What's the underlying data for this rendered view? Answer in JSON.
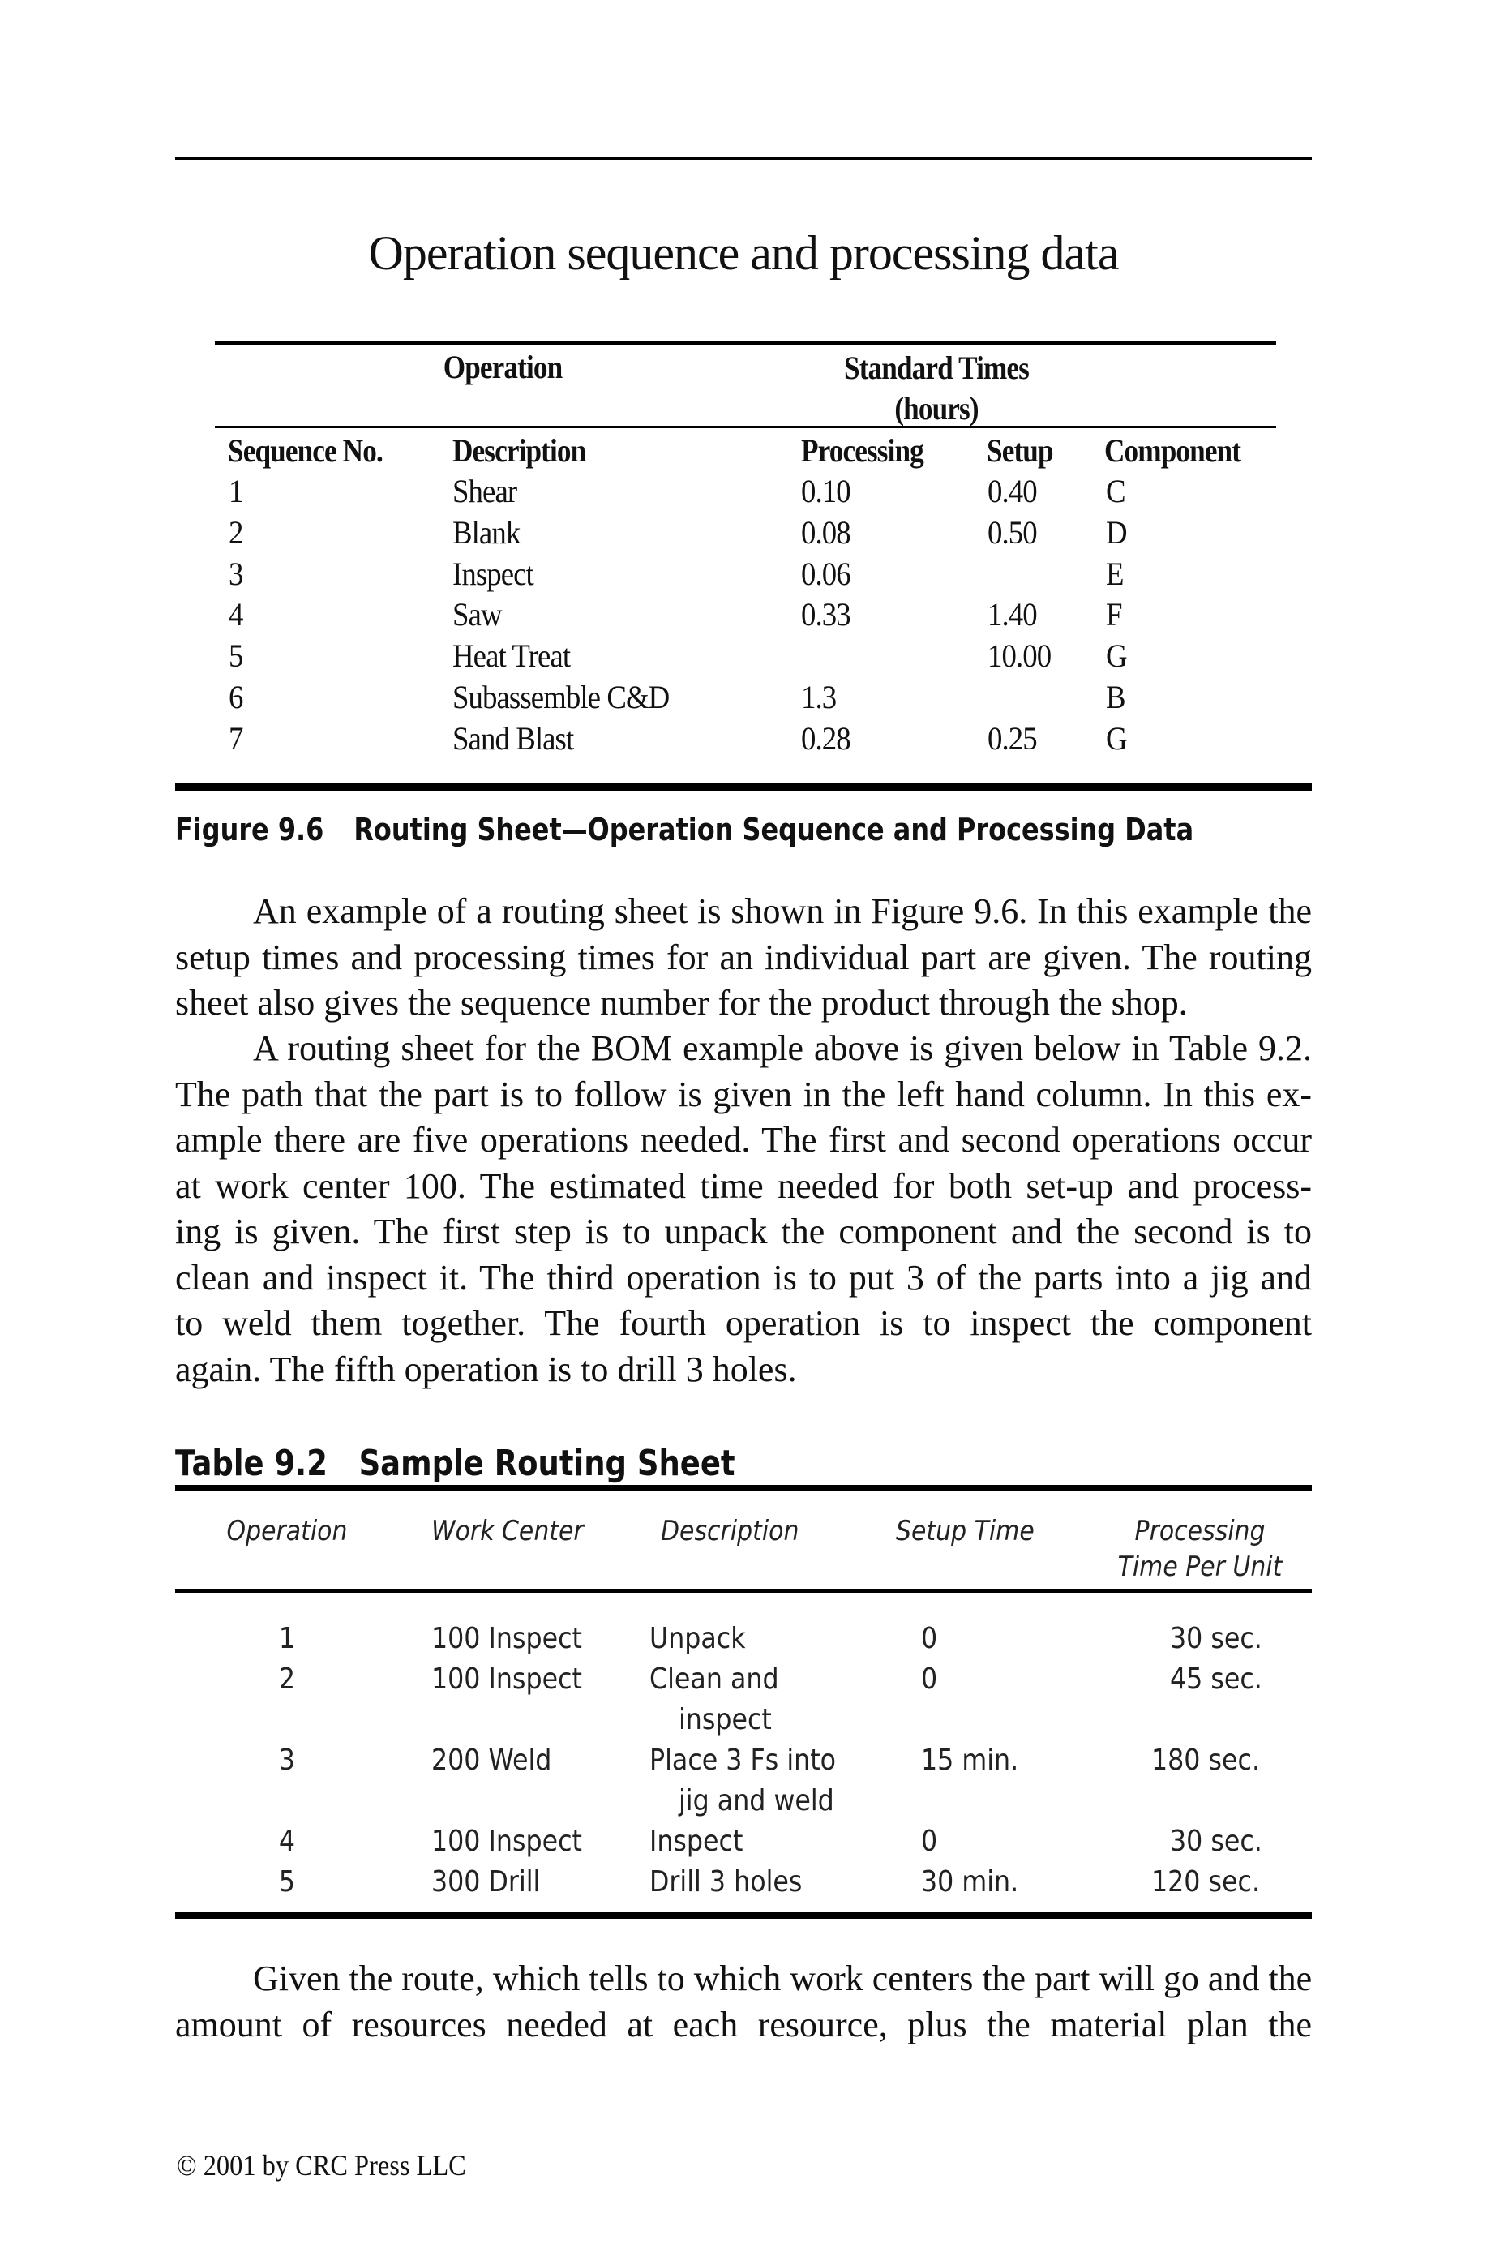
{
  "page_title": "Operation sequence and processing data",
  "figure_table": {
    "group_headers": {
      "operation": "Operation",
      "standard_times_line1": "Standard Times",
      "standard_times_line2": "(hours)"
    },
    "columns": [
      "Sequence No.",
      "Description",
      "Processing",
      "Setup",
      "Component"
    ],
    "rows": [
      {
        "seq": "1",
        "desc": "Shear",
        "proc": "0.10",
        "setup": "0.40",
        "comp": "C"
      },
      {
        "seq": "2",
        "desc": "Blank",
        "proc": "0.08",
        "setup": "0.50",
        "comp": "D"
      },
      {
        "seq": "3",
        "desc": "Inspect",
        "proc": "0.06",
        "setup": "",
        "comp": "E"
      },
      {
        "seq": "4",
        "desc": "Saw",
        "proc": "0.33",
        "setup": "1.40",
        "comp": "F"
      },
      {
        "seq": "5",
        "desc": "Heat Treat",
        "proc": "",
        "setup": "10.00",
        "comp": "G"
      },
      {
        "seq": "6",
        "desc": "Subassemble C&D",
        "proc": "1.3",
        "setup": "",
        "comp": "B"
      },
      {
        "seq": "7",
        "desc": "Sand Blast",
        "proc": "0.28",
        "setup": "0.25",
        "comp": "G"
      }
    ]
  },
  "figure_caption": {
    "label": "Figure 9.6",
    "text": "Routing Sheet—Operation Sequence and Processing Data"
  },
  "paragraph1_lines": [
    "An example of a routing sheet is shown in Figure 9.6. In this example the",
    "setup times and processing times for an individual part are given. The routing",
    "sheet also gives the sequence number for the product through the shop."
  ],
  "paragraph2_lines": [
    "A routing sheet for the BOM example above is given below in Table 9.2.",
    "The path that the part is to follow is given in the left hand column. In this ex-",
    "ample there are five operations needed. The first and second operations occur",
    "at work center 100. The estimated time needed for both set-up and process-",
    "ing is given. The first step is to unpack the component and the second is to",
    "clean and inspect it. The third operation is to put 3 of the parts into a jig and",
    "to weld them together. The fourth operation is to inspect the component",
    "again. The fifth operation is to drill 3 holes."
  ],
  "table2": {
    "label": "Table 9.2",
    "title": "Sample Routing Sheet",
    "headers": {
      "operation": "Operation",
      "work_center": "Work Center",
      "description": "Description",
      "setup_time": "Setup Time",
      "processing_line1": "Processing",
      "processing_line2": "Time Per Unit"
    },
    "rows": [
      {
        "op": "1",
        "wc": "100 Inspect",
        "desc1": "Unpack",
        "desc2": "",
        "setup": "0",
        "proc": "30 sec."
      },
      {
        "op": "2",
        "wc": "100 Inspect",
        "desc1": "Clean and",
        "desc2": "inspect",
        "setup": "0",
        "proc": "45 sec."
      },
      {
        "op": "3",
        "wc": "200 Weld",
        "desc1": "Place 3 Fs into",
        "desc2": "jig and weld",
        "setup": "15 min.",
        "proc": "180 sec."
      },
      {
        "op": "4",
        "wc": "100 Inspect",
        "desc1": "Inspect",
        "desc2": "",
        "setup": "0",
        "proc": "30 sec."
      },
      {
        "op": "5",
        "wc": "300 Drill",
        "desc1": "Drill 3 holes",
        "desc2": "",
        "setup": "30 min.",
        "proc": "120 sec."
      }
    ]
  },
  "paragraph3_lines": [
    "Given the route, which tells to which work centers the part will go and the",
    "amount of resources needed at each resource, plus the material plan the"
  ],
  "footer": "© 2001 by CRC Press LLC"
}
